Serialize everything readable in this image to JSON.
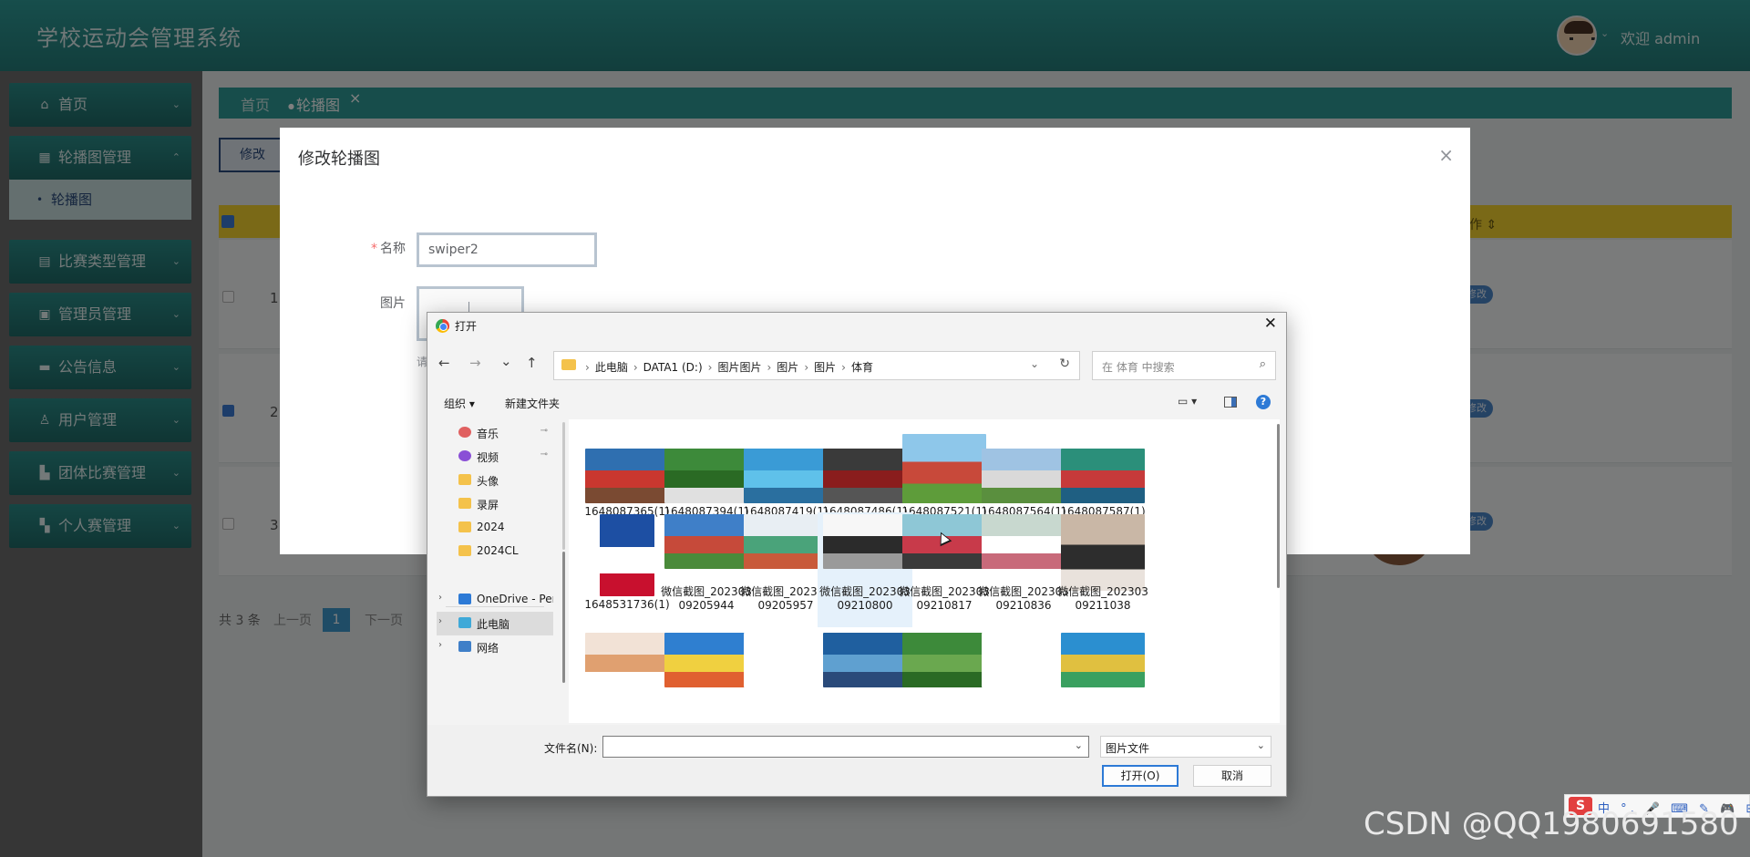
{
  "app": {
    "title": "学校运动会管理系统",
    "welcome": "欢迎 admin"
  },
  "sidebar": {
    "items": [
      {
        "icon": "home-icon",
        "glyph": "⌂",
        "label": "首页"
      },
      {
        "icon": "image-icon",
        "glyph": "▦",
        "label": "轮播图管理"
      },
      {
        "icon": "grid-icon",
        "glyph": "▤",
        "label": "比赛类型管理"
      },
      {
        "icon": "chip-icon",
        "glyph": "▣",
        "label": "管理员管理"
      },
      {
        "icon": "car-icon",
        "glyph": "▬",
        "label": "公告信息"
      },
      {
        "icon": "user-icon",
        "glyph": "♙",
        "label": "用户管理"
      },
      {
        "icon": "doc-icon",
        "glyph": "▙",
        "label": "团体比赛管理"
      },
      {
        "icon": "apps-icon",
        "glyph": "▚",
        "label": "个人赛管理"
      }
    ],
    "subitem": "轮播图"
  },
  "tags": {
    "home": "首页",
    "active": "轮播图",
    "close": "×"
  },
  "toolbar": {
    "edit_label": "修改"
  },
  "table": {
    "op_header": "作 ⇕",
    "rows": [
      {
        "index": "1",
        "checked": false,
        "action": "修改"
      },
      {
        "index": "2",
        "checked": true,
        "action": "修改"
      },
      {
        "index": "3",
        "checked": false,
        "action": "修改"
      }
    ]
  },
  "pager": {
    "total": "共 3 条",
    "prev": "上一页",
    "page": "1",
    "next": "下一页"
  },
  "edit_dialog": {
    "title": "修改轮播图",
    "close": "×",
    "name_required": "*",
    "name_label": "名称",
    "name_value": "swiper2",
    "image_label": "图片",
    "hint": "请"
  },
  "file_dialog": {
    "title": "打开",
    "close": "✕",
    "nav": {
      "back": "←",
      "forward": "→",
      "recent": "⌄",
      "up": "↑"
    },
    "breadcrumbs": [
      "此电脑",
      "DATA1 (D:)",
      "图片图片",
      "图片",
      "图片",
      "体育"
    ],
    "search_placeholder": "在 体育 中搜索",
    "organize": "组织 ▾",
    "new_folder": "新建文件夹",
    "view": "▭ ▾",
    "help": "?",
    "nav_items": [
      {
        "label": "音乐",
        "icon": "music-icon",
        "color": "#e06060",
        "pinned": true
      },
      {
        "label": "视频",
        "icon": "video-icon",
        "color": "#8a4fd6",
        "pinned": true
      },
      {
        "label": "头像",
        "icon": "folder-icon",
        "color": "#f4c24b",
        "pinned": false
      },
      {
        "label": "录屏",
        "icon": "folder-icon",
        "color": "#f4c24b",
        "pinned": false
      },
      {
        "label": "2024",
        "icon": "folder-icon",
        "color": "#f4c24b",
        "pinned": false
      },
      {
        "label": "2024CL",
        "icon": "folder-icon",
        "color": "#f4c24b",
        "pinned": false
      },
      {
        "label": "OneDrive - Per",
        "icon": "cloud-icon",
        "color": "#2d7ad6",
        "pinned": false,
        "expandable": true
      },
      {
        "label": "此电脑",
        "icon": "computer-icon",
        "color": "#3fa9d8",
        "pinned": false,
        "expandable": true,
        "selected": true
      },
      {
        "label": "网络",
        "icon": "network-icon",
        "color": "#3f7fc8",
        "pinned": false,
        "expandable": true
      }
    ],
    "files": [
      {
        "name": "1648087365(1)",
        "colors": [
          "#2f6fb0",
          "#c9372f",
          "#7a4a32"
        ]
      },
      {
        "name": "1648087394(1)",
        "colors": [
          "#3d8a3a",
          "#2a6a24",
          "#e0e0e0"
        ]
      },
      {
        "name": "1648087419(1)",
        "colors": [
          "#3a9bd6",
          "#5fc1ea",
          "#2a6f9f"
        ]
      },
      {
        "name": "1648087486(1)",
        "colors": [
          "#3a3a3a",
          "#8a1d1d",
          "#555555"
        ]
      },
      {
        "name": "1648087521(1)",
        "colors": [
          "#8ec7ea",
          "#c8493a",
          "#5e9c3a"
        ]
      },
      {
        "name": "1648087564(1)",
        "colors": [
          "#9fc3e3",
          "#d9d9d9",
          "#5a8f3e"
        ]
      },
      {
        "name": "1648087587(1)",
        "colors": [
          "#2b8f7a",
          "#c63a3a",
          "#1f5f82"
        ]
      },
      {
        "name": "1648531736(1)",
        "colors": [
          "#1d4fa3",
          "#ffffff",
          "#c8102e"
        ]
      },
      {
        "name": "微信截图_20230309205944",
        "colors": [
          "#3f7fc8",
          "#c64a3a",
          "#4a8a3a"
        ]
      },
      {
        "name": "微信截图_20230309205957",
        "colors": [
          "#e8eef3",
          "#4aa37a",
          "#c85a3a"
        ]
      },
      {
        "name": "微信截图_20230309210800",
        "colors": [
          "#f7f7f7",
          "#2b2b2b",
          "#9a9a9a"
        ],
        "selected": true
      },
      {
        "name": "微信截图_20230309210817",
        "colors": [
          "#8ec7d6",
          "#c83a4a",
          "#3a3a3a"
        ]
      },
      {
        "name": "微信截图_20230309210836",
        "colors": [
          "#c8d8cf",
          "#ffffff",
          "#c86a7a"
        ]
      },
      {
        "name": "微信截图_20230309211038",
        "colors": [
          "#c9b7a6",
          "#2d2d2d",
          "#e9e2dc"
        ]
      },
      {
        "name": "",
        "colors": [
          "#f2e2d6",
          "#e0a070",
          "#ffffff"
        ]
      },
      {
        "name": "",
        "colors": [
          "#2f7fd0",
          "#f0d040",
          "#e06030"
        ]
      },
      {
        "name": "",
        "colors": [
          "#ffffff",
          "#ffffff",
          "#ffffff"
        ]
      },
      {
        "name": "",
        "colors": [
          "#1f5f9f",
          "#5fa0d0",
          "#2a4a7a"
        ]
      },
      {
        "name": "",
        "colors": [
          "#3d8a3a",
          "#6aa84f",
          "#2a6a24"
        ]
      },
      {
        "name": "",
        "colors": [
          "#ffffff",
          "#ffffff",
          "#ffffff"
        ]
      },
      {
        "name": "",
        "colors": [
          "#2b8fd0",
          "#e0c040",
          "#3aa060"
        ]
      }
    ],
    "filename_label": "文件名(N):",
    "filename_value": "",
    "filter": "图片文件",
    "open_label": "打开(O)",
    "cancel_label": "取消"
  },
  "ime": {
    "logo": "S",
    "text": "中 °, 🎤 ⌨ ✎ 🎮 ⊞"
  },
  "watermark": "CSDN @QQ1980691580"
}
